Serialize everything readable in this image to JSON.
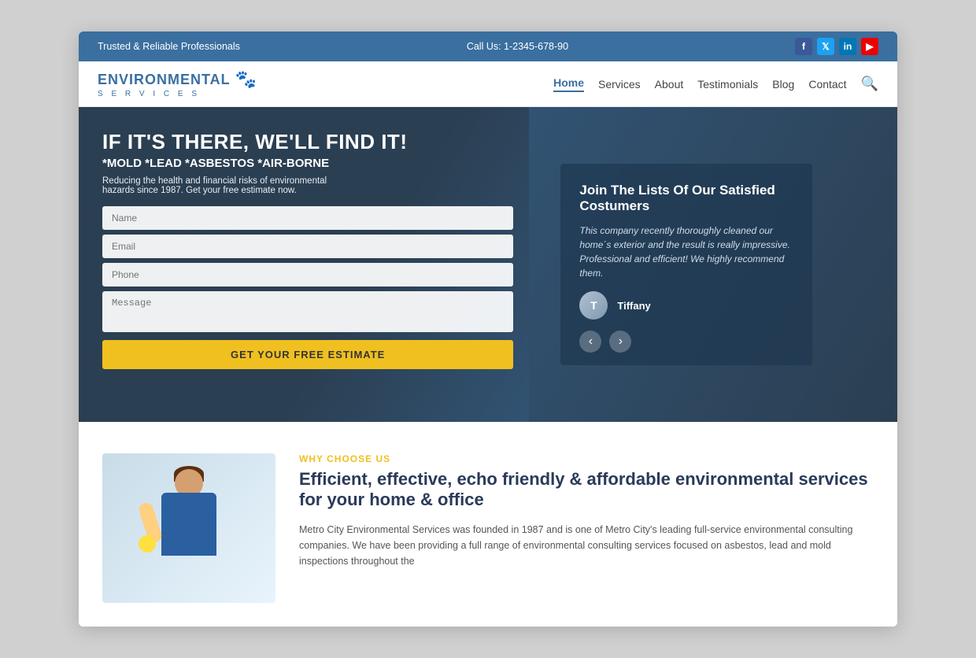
{
  "browser": {
    "frame_bg": "#d0d0d0"
  },
  "topbar": {
    "tagline": "Trusted & Reliable Professionals",
    "phone_label": "Call Us: 1-2345-678-90",
    "social": [
      {
        "name": "facebook",
        "symbol": "f",
        "class": "si-fb"
      },
      {
        "name": "twitter",
        "symbol": "t",
        "class": "si-tw"
      },
      {
        "name": "linkedin",
        "symbol": "in",
        "class": "si-li"
      },
      {
        "name": "youtube",
        "symbol": "▶",
        "class": "si-yt"
      }
    ]
  },
  "nav": {
    "logo_top": "ENVIRONMENTAL",
    "logo_bottom": "S E R V I C E S",
    "logo_icon": "🐾",
    "links": [
      {
        "label": "Home",
        "active": true
      },
      {
        "label": "Services",
        "active": false
      },
      {
        "label": "About",
        "active": false
      },
      {
        "label": "Testimonials",
        "active": false
      },
      {
        "label": "Blog",
        "active": false
      },
      {
        "label": "Contact",
        "active": false
      }
    ]
  },
  "hero": {
    "title": "IF IT'S THERE, WE'LL FIND IT!",
    "subtitle": "*MOLD *LEAD *ASBESTOS *AIR-BORNE",
    "description": "Reducing the health and financial risks of environmental hazards since 1987. Get your free estimate now.",
    "form": {
      "name_placeholder": "Name",
      "email_placeholder": "Email",
      "phone_placeholder": "Phone",
      "message_placeholder": "Message",
      "btn_label": "GET YOUR FREE ESTIMATE"
    },
    "testimonial": {
      "title": "Join The Lists Of Our Satisfied Costumers",
      "text": "This company recently thoroughly cleaned our home´s exterior and the result is really impressive. Professional and efficient! We highly recommend them.",
      "author": "Tiffany",
      "prev": "‹",
      "next": "›"
    }
  },
  "why": {
    "label": "WHY CHOOSE US",
    "title": "Efficient, effective, echo friendly & affordable environmental services for your home & office",
    "text": "Metro City Environmental Services was founded in 1987 and is one of Metro City's leading full-service environmental consulting companies. We have been providing a full range of environmental consulting services focused on asbestos, lead and mold inspections throughout the"
  }
}
